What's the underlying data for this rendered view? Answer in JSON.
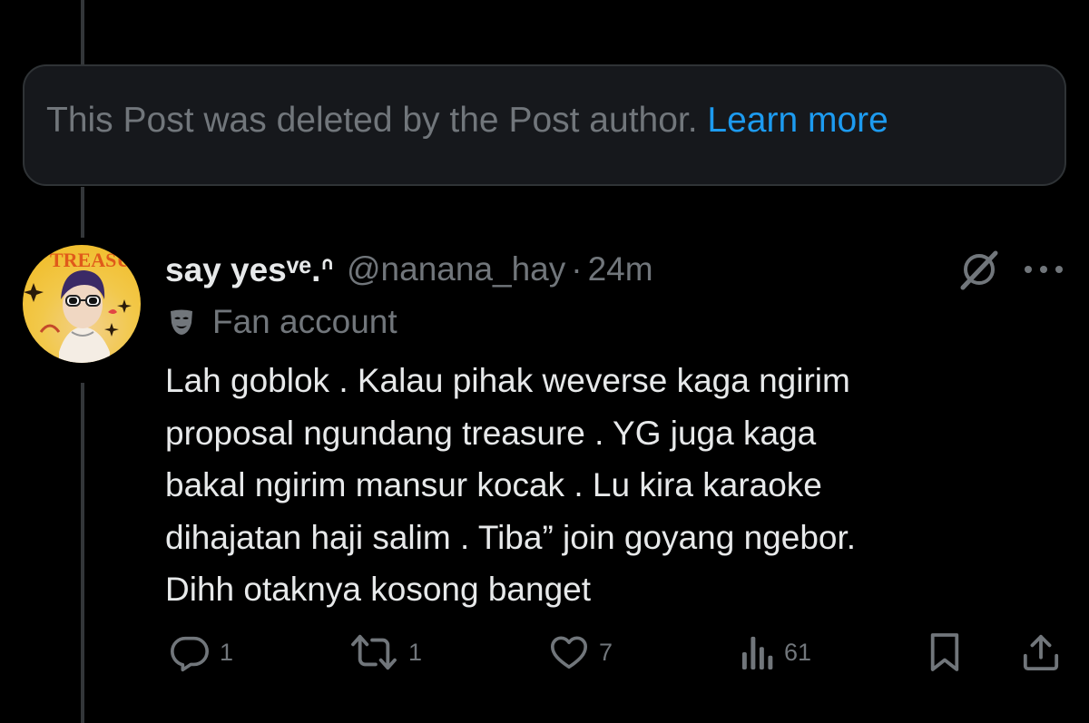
{
  "deleted_notice": {
    "text": "This Post was deleted by the Post author.",
    "link": "Learn more"
  },
  "post": {
    "display_name": "say yesᵛᵉ.ᐢ",
    "handle": "@nanana_hay",
    "separator": "·",
    "timestamp": "24m",
    "badge_label": "Fan account",
    "text_lines": [
      "Lah goblok . Kalau pihak weverse kaga ngirim",
      "proposal ngundang treasure . YG juga kaga",
      "bakal ngirim mansur kocak . Lu kira karaoke",
      "dihajatan haji salim . Tiba” join goyang ngebor.",
      "Dihh otaknya kosong banget"
    ],
    "avatar_text": "TREASURE"
  },
  "actions": {
    "replies": "1",
    "reposts": "1",
    "likes": "7",
    "views": "61"
  },
  "icons": {
    "reply": "reply-icon",
    "repost": "repost-icon",
    "like": "heart-icon",
    "views": "views-icon",
    "bookmark": "bookmark-icon",
    "share": "share-icon",
    "grok": "grok-icon",
    "more": "more-icon",
    "badge": "mask-icon"
  },
  "colors": {
    "background": "#000000",
    "text_primary": "#e7e9ea",
    "text_secondary": "#71767b",
    "link": "#1d9bf0",
    "notice_bg": "#16181c",
    "border": "#2f3336"
  }
}
